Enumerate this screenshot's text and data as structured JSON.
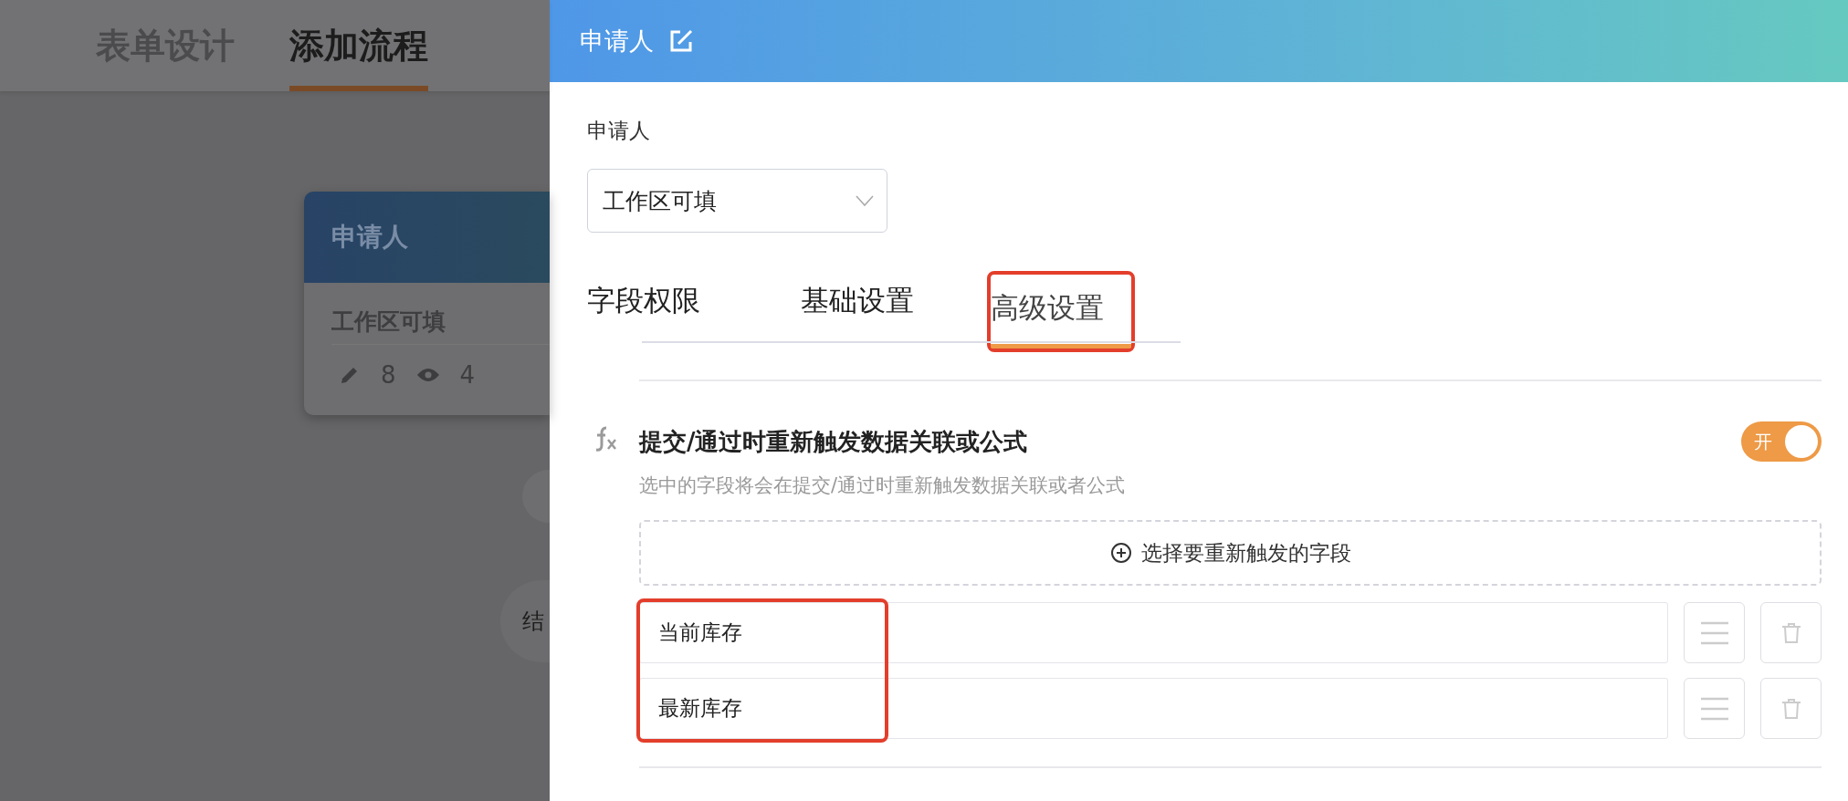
{
  "background": {
    "tabs": [
      {
        "label": "表单设计",
        "selected": false
      },
      {
        "label": "添加流程",
        "selected": true
      }
    ],
    "node": {
      "title": "申请人",
      "subtitle": "工作区可填",
      "edit_count": "8",
      "view_count": "4"
    },
    "end_node": {
      "label": "结"
    }
  },
  "drawer": {
    "title": "申请人",
    "field_label": "申请人",
    "select_value": "工作区可填",
    "tabs": [
      {
        "label": "字段权限",
        "selected": false,
        "highlighted": false
      },
      {
        "label": "基础设置",
        "selected": false,
        "highlighted": false
      },
      {
        "label": "高级设置",
        "selected": true,
        "highlighted": true
      }
    ],
    "setting": {
      "title": "提交/通过时重新触发数据关联或公式",
      "description": "选中的字段将会在提交/通过时重新触发数据关联或者公式",
      "toggle": {
        "on": true,
        "label": "开"
      },
      "add_button": "选择要重新触发的字段",
      "fields_highlighted": true,
      "fields": [
        {
          "name": "当前库存"
        },
        {
          "name": "最新库存"
        }
      ]
    }
  }
}
